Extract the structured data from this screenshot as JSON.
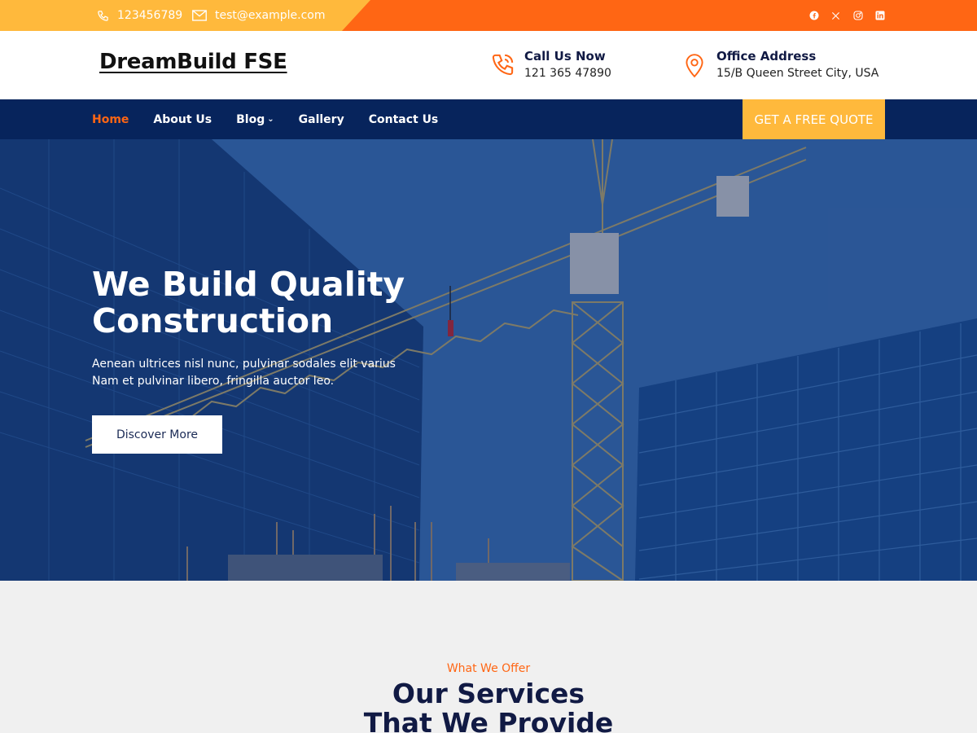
{
  "topbar": {
    "phone": "123456789",
    "email": "test@example.com",
    "colors": {
      "orange": "#ff6614",
      "yellow": "#ffb93c"
    },
    "socials": [
      "facebook-icon",
      "x-icon",
      "instagram-icon",
      "linkedin-icon"
    ]
  },
  "header": {
    "logo": "DreamBuild FSE",
    "call": {
      "title": "Call Us Now",
      "value": "121 365 47890",
      "icon": "phone-icon"
    },
    "address": {
      "title": "Office Address",
      "value": "15/B Queen Street City, USA",
      "icon": "map-pin-icon"
    }
  },
  "nav": {
    "items": [
      {
        "label": "Home",
        "active": true
      },
      {
        "label": "About Us"
      },
      {
        "label": "Blog",
        "has_dropdown": true
      },
      {
        "label": "Gallery"
      },
      {
        "label": "Contact Us"
      }
    ],
    "cta": "GET A FREE QUOTE",
    "background": "#07245c"
  },
  "hero": {
    "title": "We Build Quality Construction",
    "subtitle": "Aenean ultrices nisl nunc, pulvinar sodales elit varius Nam et pulvinar libero, fringilla auctor leo.",
    "button": "Discover More"
  },
  "services": {
    "eyebrow": "What We Offer",
    "title": "Our Services That We Provide"
  }
}
